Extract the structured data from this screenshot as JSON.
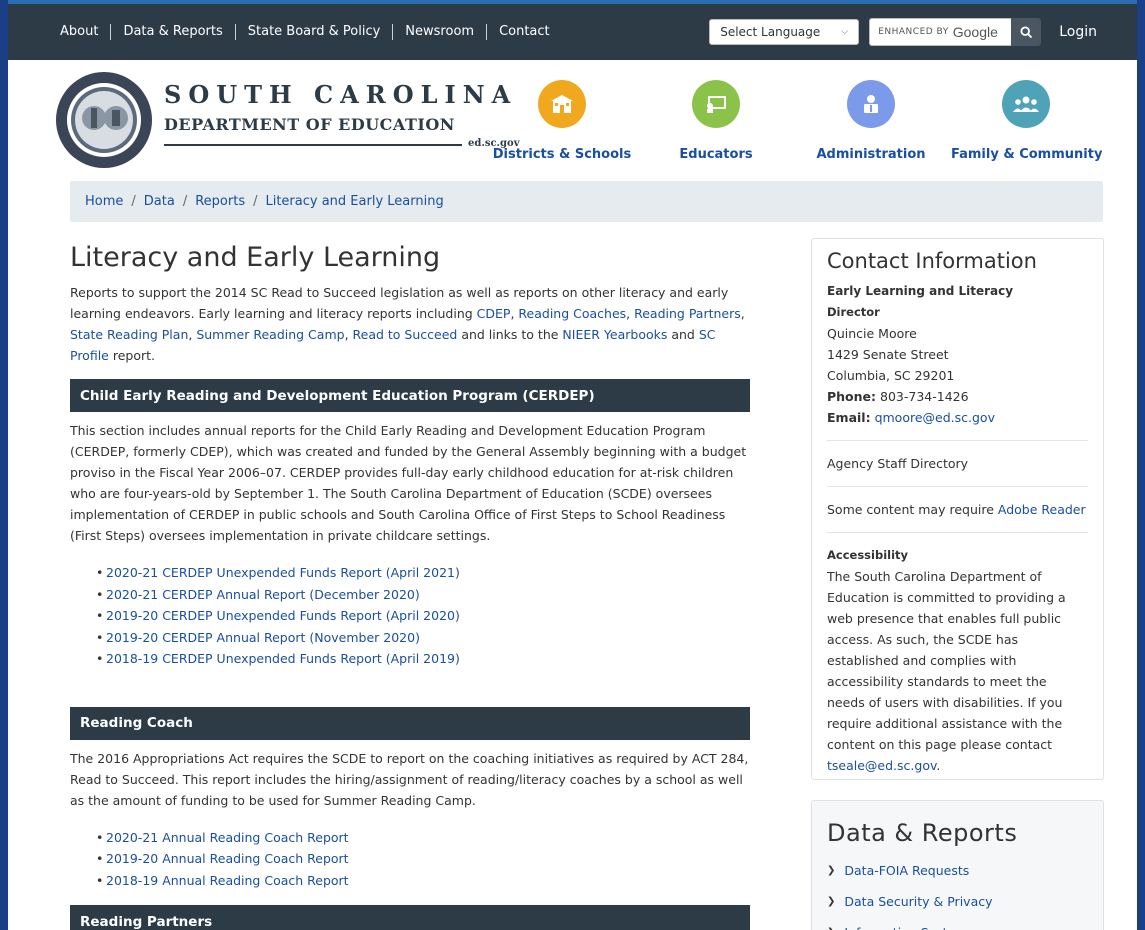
{
  "topnav": {
    "items": [
      "About",
      "Data & Reports",
      "State Board & Policy",
      "Newsroom",
      "Contact"
    ],
    "language_select": "Select Language",
    "search_prefix": "ENHANCED BY",
    "search_brand": "Google",
    "login": "Login"
  },
  "header": {
    "logo_line1": "SOUTH CAROLINA",
    "logo_line2": "DEPARTMENT OF EDUCATION",
    "logo_domain": "ed.sc.gov",
    "seal_text": "SOUTH CAROLINA DEPARTMENT OF EDUCATION",
    "categories": [
      {
        "label": "Districts & Schools",
        "icon": "school-icon",
        "color": "#f0a81e"
      },
      {
        "label": "Educators",
        "icon": "teacher-board-icon",
        "color": "#8bc34a"
      },
      {
        "label": "Administration",
        "icon": "admin-person-icon",
        "color": "#7b9bea"
      },
      {
        "label": "Family & Community",
        "icon": "family-group-icon",
        "color": "#4fa3b8"
      }
    ]
  },
  "breadcrumb": [
    "Home",
    "Data",
    "Reports",
    "Literacy and Early Learning"
  ],
  "main": {
    "title": "Literacy and Early Learning",
    "intro_prefix": "Reports to support the 2014 SC Read to Succeed legislation as well as reports on other literacy and early learning endeavors.  Early learning and literacy reports including ",
    "intro_links": [
      "CDEP",
      "Reading Coaches",
      "Reading Partners",
      "State Reading Plan",
      "Summer Reading Camp",
      "Read to Succeed",
      "NIEER Yearbooks",
      "SC Profile"
    ],
    "intro_middle_and": " and links to the ",
    "intro_middle_and2": " and ",
    "intro_suffix": " report.",
    "sections": [
      {
        "heading": "Child Early Reading and Development Education Program (CERDEP)",
        "body": "This section includes annual reports for the Child Early Reading and Development Education Program (CERDEP, formerly CDEP), which was created and funded by the General Assembly beginning with a budget proviso in the Fiscal Year 2006–07. CERDEP provides full-day early childhood education for at-risk children who are four-years-old by September 1. The South Carolina Department of Education (SCDE) oversees implementation of CERDEP in public schools and South Carolina Office of First Steps to School Readiness (First Steps) oversees implementation in private childcare settings.",
        "links": [
          "2020-21 CERDEP Unexpended Funds Report (April 2021)",
          "2020-21 CERDEP Annual Report (December 2020)",
          "2019-20 CERDEP Unexpended Funds Report (April 2020)",
          "2019-20 CERDEP Annual Report (November 2020)",
          "2018-19 CERDEP Unexpended Funds Report (April 2019)"
        ]
      },
      {
        "heading": "Reading Coach",
        "body": "The 2016 Appropriations Act requires the SCDE to report on the coaching initiatives as required by ACT 284, Read to Succeed. This report includes the hiring/assignment of reading/literacy coaches by a school as well as the amount of funding to be used for Summer Reading Camp.",
        "links": [
          "2020-21 Annual Reading Coach Report",
          "2019-20 Annual Reading Coach Report",
          "2018-19 Annual Reading Coach Report"
        ]
      },
      {
        "heading": "Reading Partners",
        "body": ""
      }
    ]
  },
  "contact": {
    "title": "Contact Information",
    "office": "Early Learning and Literacy",
    "role": "Director",
    "name": "Quincie Moore",
    "street": "1429 Senate Street",
    "city": "Columbia, SC 29201",
    "phone_label": "Phone:",
    "phone": "803-734-1426",
    "email_label": "Email:",
    "email": "qmoore@ed.sc.gov",
    "staff_directory": "Agency Staff Directory",
    "reader_prefix": "Some content may require ",
    "reader_link": "Adobe Reader",
    "accessibility_title": "Accessibility",
    "accessibility_body": "The South Carolina Department of Education is committed to providing a web presence that enables full public access. As such, the SCDE has established and complies with accessibility standards to meet the needs of users with disabilities. If you require additional assistance with the content on this page please contact ",
    "accessibility_email": "tseale@ed.sc.gov",
    "accessibility_end": "."
  },
  "data_reports": {
    "title": "Data & Reports",
    "items": [
      "Data-FOIA Requests",
      "Data Security & Privacy",
      "Information Systems"
    ]
  },
  "colors": {
    "dark_bar": "#2d3b47",
    "link": "#1a4fa0",
    "breadcrumb_bg": "#e5ebef"
  }
}
